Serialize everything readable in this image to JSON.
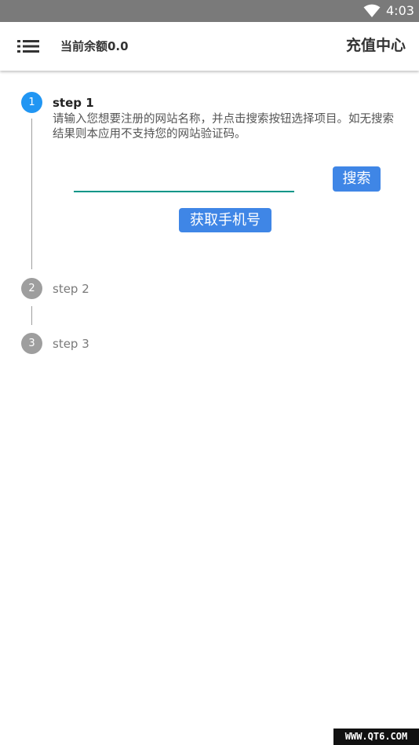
{
  "status_bar": {
    "time": "4:03",
    "icons": [
      "wifi-icon"
    ]
  },
  "app_bar": {
    "menu_icon": "menu-icon",
    "balance_text": "当前余额0.0",
    "title": "充值中心"
  },
  "stepper": {
    "steps": [
      {
        "number": "1",
        "title": "step 1",
        "description": "请输入您想要注册的网站名称，并点击搜索按钮选择项目。如无搜索结果则本应用不支持您的网站验证码。",
        "state": "active"
      },
      {
        "number": "2",
        "title": "step 2",
        "state": "inactive"
      },
      {
        "number": "3",
        "title": "step 3",
        "state": "inactive"
      }
    ],
    "input_value": "",
    "input_placeholder": "",
    "search_label": "搜索",
    "get_phone_label": "获取手机号"
  },
  "watermark": "WWW.QT6.COM",
  "colors": {
    "status_bar": "#7a7a7a",
    "active_step": "#2196f3",
    "inactive_step": "#9e9e9e",
    "button": "#3f86e6",
    "input_underline": "#009688"
  }
}
